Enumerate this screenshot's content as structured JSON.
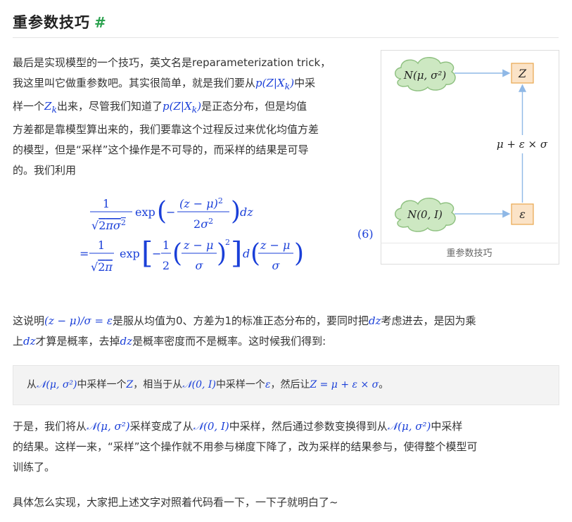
{
  "heading": {
    "title": "重参数技巧",
    "anchor": "#"
  },
  "intro": {
    "l1": "最后是实现模型的一个技巧，英文名是reparameterization trick，",
    "l2a": "我这里叫它做重参数吧。其实很简单，就是我们要从",
    "m_pzx": "p(Z|X",
    "m_pzx_sub": "k",
    "l2b": "中采",
    "l3a": "样一个",
    "m_zk": "Z",
    "m_zk_sub": "k",
    "l3b": "出来，尽管我们知道了",
    "l3c": "是正态分布，但是均值",
    "l4": "方差都是靠模型算出来的，我们要靠这个过程反过来优化均值方差",
    "l5": "的模型，但是“采样”这个操作是不可导的，而采样的结果是可导",
    "l6": "的。我们利用"
  },
  "figure": {
    "node_top_cloud": "N(μ, σ²)",
    "node_z": "Z",
    "edge_label": "μ + ε × σ",
    "node_bottom_cloud": "N(0, I)",
    "node_eps": "ε",
    "caption": "重参数技巧"
  },
  "equation": {
    "number": "(6)"
  },
  "para2": {
    "a": "这说明",
    "m1": "(z − μ)/σ = ε",
    "b": "是服从均值为0、方差为1的标准正态分布的，要同时把",
    "m_dz": "dz",
    "c": "考虑进去，是因为乘",
    "d": "上",
    "e": "才算是概率，去掉",
    "f": "是概率密度而不是概率。这时候我们得到:"
  },
  "quote": {
    "a": "从",
    "m1": "𝒩(μ, σ²)",
    "b": "中采样一个",
    "m2": "Z",
    "c": "，相当于从",
    "m3": "𝒩(0, I)",
    "d": "中采样一个",
    "m4": "ε",
    "e": "，然后让",
    "m5": "Z = μ + ε × σ",
    "f": "。"
  },
  "para3": {
    "a": "于是，我们将从",
    "m1": "𝒩(μ, σ²)",
    "b": "采样变成了从",
    "m2": "𝒩(0, I)",
    "c": "中采样，然后通过参数变换得到从",
    "m3": "𝒩(μ, σ²)",
    "d": "中采样",
    "l2": "的结果。这样一来，“采样”这个操作就不用参与梯度下降了，改为采样的结果参与，使得整个模型可",
    "l3": "训练了。"
  },
  "para4": "具体怎么实现，大家把上述文字对照着代码看一下，一下子就明白了~"
}
